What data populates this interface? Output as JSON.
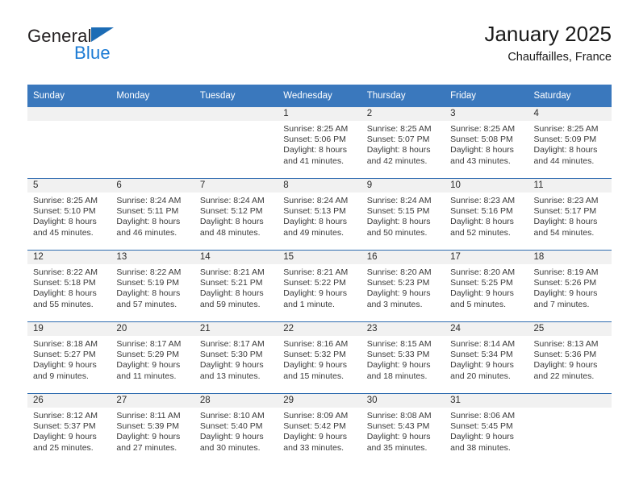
{
  "logo": {
    "word_top": "General",
    "word_bottom": "Blue",
    "triangle_color": "#1c6cb5",
    "blue_color": "#1c7bd4"
  },
  "header": {
    "title": "January 2025",
    "subtitle": "Chauffailles, France"
  },
  "calendar": {
    "header_color": "#3a78bd",
    "daynum_band_color": "#f1f1f1",
    "grid_line_color": "#2f6cb0",
    "weekday_headers": [
      "Sunday",
      "Monday",
      "Tuesday",
      "Wednesday",
      "Thursday",
      "Friday",
      "Saturday"
    ],
    "weeks": [
      [
        {
          "day": "",
          "empty": true,
          "sunrise": "",
          "sunset": "",
          "daylight_line1": "",
          "daylight_line2": ""
        },
        {
          "day": "",
          "empty": true,
          "sunrise": "",
          "sunset": "",
          "daylight_line1": "",
          "daylight_line2": ""
        },
        {
          "day": "",
          "empty": true,
          "sunrise": "",
          "sunset": "",
          "daylight_line1": "",
          "daylight_line2": ""
        },
        {
          "day": "1",
          "empty": false,
          "sunrise": "Sunrise: 8:25 AM",
          "sunset": "Sunset: 5:06 PM",
          "daylight_line1": "Daylight: 8 hours",
          "daylight_line2": "and 41 minutes."
        },
        {
          "day": "2",
          "empty": false,
          "sunrise": "Sunrise: 8:25 AM",
          "sunset": "Sunset: 5:07 PM",
          "daylight_line1": "Daylight: 8 hours",
          "daylight_line2": "and 42 minutes."
        },
        {
          "day": "3",
          "empty": false,
          "sunrise": "Sunrise: 8:25 AM",
          "sunset": "Sunset: 5:08 PM",
          "daylight_line1": "Daylight: 8 hours",
          "daylight_line2": "and 43 minutes."
        },
        {
          "day": "4",
          "empty": false,
          "sunrise": "Sunrise: 8:25 AM",
          "sunset": "Sunset: 5:09 PM",
          "daylight_line1": "Daylight: 8 hours",
          "daylight_line2": "and 44 minutes."
        }
      ],
      [
        {
          "day": "5",
          "empty": false,
          "sunrise": "Sunrise: 8:25 AM",
          "sunset": "Sunset: 5:10 PM",
          "daylight_line1": "Daylight: 8 hours",
          "daylight_line2": "and 45 minutes."
        },
        {
          "day": "6",
          "empty": false,
          "sunrise": "Sunrise: 8:24 AM",
          "sunset": "Sunset: 5:11 PM",
          "daylight_line1": "Daylight: 8 hours",
          "daylight_line2": "and 46 minutes."
        },
        {
          "day": "7",
          "empty": false,
          "sunrise": "Sunrise: 8:24 AM",
          "sunset": "Sunset: 5:12 PM",
          "daylight_line1": "Daylight: 8 hours",
          "daylight_line2": "and 48 minutes."
        },
        {
          "day": "8",
          "empty": false,
          "sunrise": "Sunrise: 8:24 AM",
          "sunset": "Sunset: 5:13 PM",
          "daylight_line1": "Daylight: 8 hours",
          "daylight_line2": "and 49 minutes."
        },
        {
          "day": "9",
          "empty": false,
          "sunrise": "Sunrise: 8:24 AM",
          "sunset": "Sunset: 5:15 PM",
          "daylight_line1": "Daylight: 8 hours",
          "daylight_line2": "and 50 minutes."
        },
        {
          "day": "10",
          "empty": false,
          "sunrise": "Sunrise: 8:23 AM",
          "sunset": "Sunset: 5:16 PM",
          "daylight_line1": "Daylight: 8 hours",
          "daylight_line2": "and 52 minutes."
        },
        {
          "day": "11",
          "empty": false,
          "sunrise": "Sunrise: 8:23 AM",
          "sunset": "Sunset: 5:17 PM",
          "daylight_line1": "Daylight: 8 hours",
          "daylight_line2": "and 54 minutes."
        }
      ],
      [
        {
          "day": "12",
          "empty": false,
          "sunrise": "Sunrise: 8:22 AM",
          "sunset": "Sunset: 5:18 PM",
          "daylight_line1": "Daylight: 8 hours",
          "daylight_line2": "and 55 minutes."
        },
        {
          "day": "13",
          "empty": false,
          "sunrise": "Sunrise: 8:22 AM",
          "sunset": "Sunset: 5:19 PM",
          "daylight_line1": "Daylight: 8 hours",
          "daylight_line2": "and 57 minutes."
        },
        {
          "day": "14",
          "empty": false,
          "sunrise": "Sunrise: 8:21 AM",
          "sunset": "Sunset: 5:21 PM",
          "daylight_line1": "Daylight: 8 hours",
          "daylight_line2": "and 59 minutes."
        },
        {
          "day": "15",
          "empty": false,
          "sunrise": "Sunrise: 8:21 AM",
          "sunset": "Sunset: 5:22 PM",
          "daylight_line1": "Daylight: 9 hours",
          "daylight_line2": "and 1 minute."
        },
        {
          "day": "16",
          "empty": false,
          "sunrise": "Sunrise: 8:20 AM",
          "sunset": "Sunset: 5:23 PM",
          "daylight_line1": "Daylight: 9 hours",
          "daylight_line2": "and 3 minutes."
        },
        {
          "day": "17",
          "empty": false,
          "sunrise": "Sunrise: 8:20 AM",
          "sunset": "Sunset: 5:25 PM",
          "daylight_line1": "Daylight: 9 hours",
          "daylight_line2": "and 5 minutes."
        },
        {
          "day": "18",
          "empty": false,
          "sunrise": "Sunrise: 8:19 AM",
          "sunset": "Sunset: 5:26 PM",
          "daylight_line1": "Daylight: 9 hours",
          "daylight_line2": "and 7 minutes."
        }
      ],
      [
        {
          "day": "19",
          "empty": false,
          "sunrise": "Sunrise: 8:18 AM",
          "sunset": "Sunset: 5:27 PM",
          "daylight_line1": "Daylight: 9 hours",
          "daylight_line2": "and 9 minutes."
        },
        {
          "day": "20",
          "empty": false,
          "sunrise": "Sunrise: 8:17 AM",
          "sunset": "Sunset: 5:29 PM",
          "daylight_line1": "Daylight: 9 hours",
          "daylight_line2": "and 11 minutes."
        },
        {
          "day": "21",
          "empty": false,
          "sunrise": "Sunrise: 8:17 AM",
          "sunset": "Sunset: 5:30 PM",
          "daylight_line1": "Daylight: 9 hours",
          "daylight_line2": "and 13 minutes."
        },
        {
          "day": "22",
          "empty": false,
          "sunrise": "Sunrise: 8:16 AM",
          "sunset": "Sunset: 5:32 PM",
          "daylight_line1": "Daylight: 9 hours",
          "daylight_line2": "and 15 minutes."
        },
        {
          "day": "23",
          "empty": false,
          "sunrise": "Sunrise: 8:15 AM",
          "sunset": "Sunset: 5:33 PM",
          "daylight_line1": "Daylight: 9 hours",
          "daylight_line2": "and 18 minutes."
        },
        {
          "day": "24",
          "empty": false,
          "sunrise": "Sunrise: 8:14 AM",
          "sunset": "Sunset: 5:34 PM",
          "daylight_line1": "Daylight: 9 hours",
          "daylight_line2": "and 20 minutes."
        },
        {
          "day": "25",
          "empty": false,
          "sunrise": "Sunrise: 8:13 AM",
          "sunset": "Sunset: 5:36 PM",
          "daylight_line1": "Daylight: 9 hours",
          "daylight_line2": "and 22 minutes."
        }
      ],
      [
        {
          "day": "26",
          "empty": false,
          "sunrise": "Sunrise: 8:12 AM",
          "sunset": "Sunset: 5:37 PM",
          "daylight_line1": "Daylight: 9 hours",
          "daylight_line2": "and 25 minutes."
        },
        {
          "day": "27",
          "empty": false,
          "sunrise": "Sunrise: 8:11 AM",
          "sunset": "Sunset: 5:39 PM",
          "daylight_line1": "Daylight: 9 hours",
          "daylight_line2": "and 27 minutes."
        },
        {
          "day": "28",
          "empty": false,
          "sunrise": "Sunrise: 8:10 AM",
          "sunset": "Sunset: 5:40 PM",
          "daylight_line1": "Daylight: 9 hours",
          "daylight_line2": "and 30 minutes."
        },
        {
          "day": "29",
          "empty": false,
          "sunrise": "Sunrise: 8:09 AM",
          "sunset": "Sunset: 5:42 PM",
          "daylight_line1": "Daylight: 9 hours",
          "daylight_line2": "and 33 minutes."
        },
        {
          "day": "30",
          "empty": false,
          "sunrise": "Sunrise: 8:08 AM",
          "sunset": "Sunset: 5:43 PM",
          "daylight_line1": "Daylight: 9 hours",
          "daylight_line2": "and 35 minutes."
        },
        {
          "day": "31",
          "empty": false,
          "sunrise": "Sunrise: 8:06 AM",
          "sunset": "Sunset: 5:45 PM",
          "daylight_line1": "Daylight: 9 hours",
          "daylight_line2": "and 38 minutes."
        },
        {
          "day": "",
          "empty": true,
          "sunrise": "",
          "sunset": "",
          "daylight_line1": "",
          "daylight_line2": ""
        }
      ]
    ]
  }
}
